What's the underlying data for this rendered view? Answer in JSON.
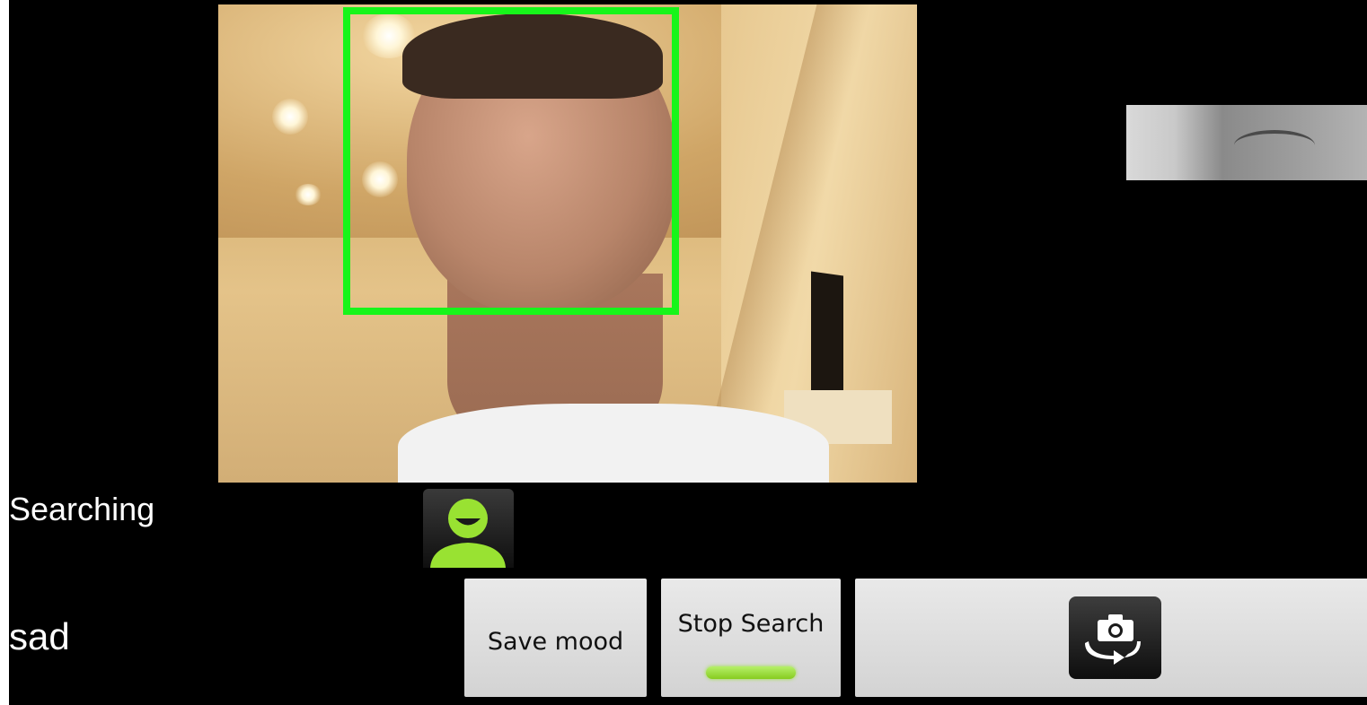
{
  "status": {
    "state_text": "Searching",
    "mood_text": "sad"
  },
  "buttons": {
    "save_mood_label": "Save mood",
    "stop_search_label": "Stop Search",
    "stop_search_active": true,
    "switch_camera_icon": "switch-camera-icon"
  },
  "icons": {
    "avatar": "user-avatar-icon"
  },
  "colors": {
    "face_box": "#17f51a",
    "background": "#000000",
    "active_indicator": "#99e232",
    "avatar_green": "#99e232"
  }
}
